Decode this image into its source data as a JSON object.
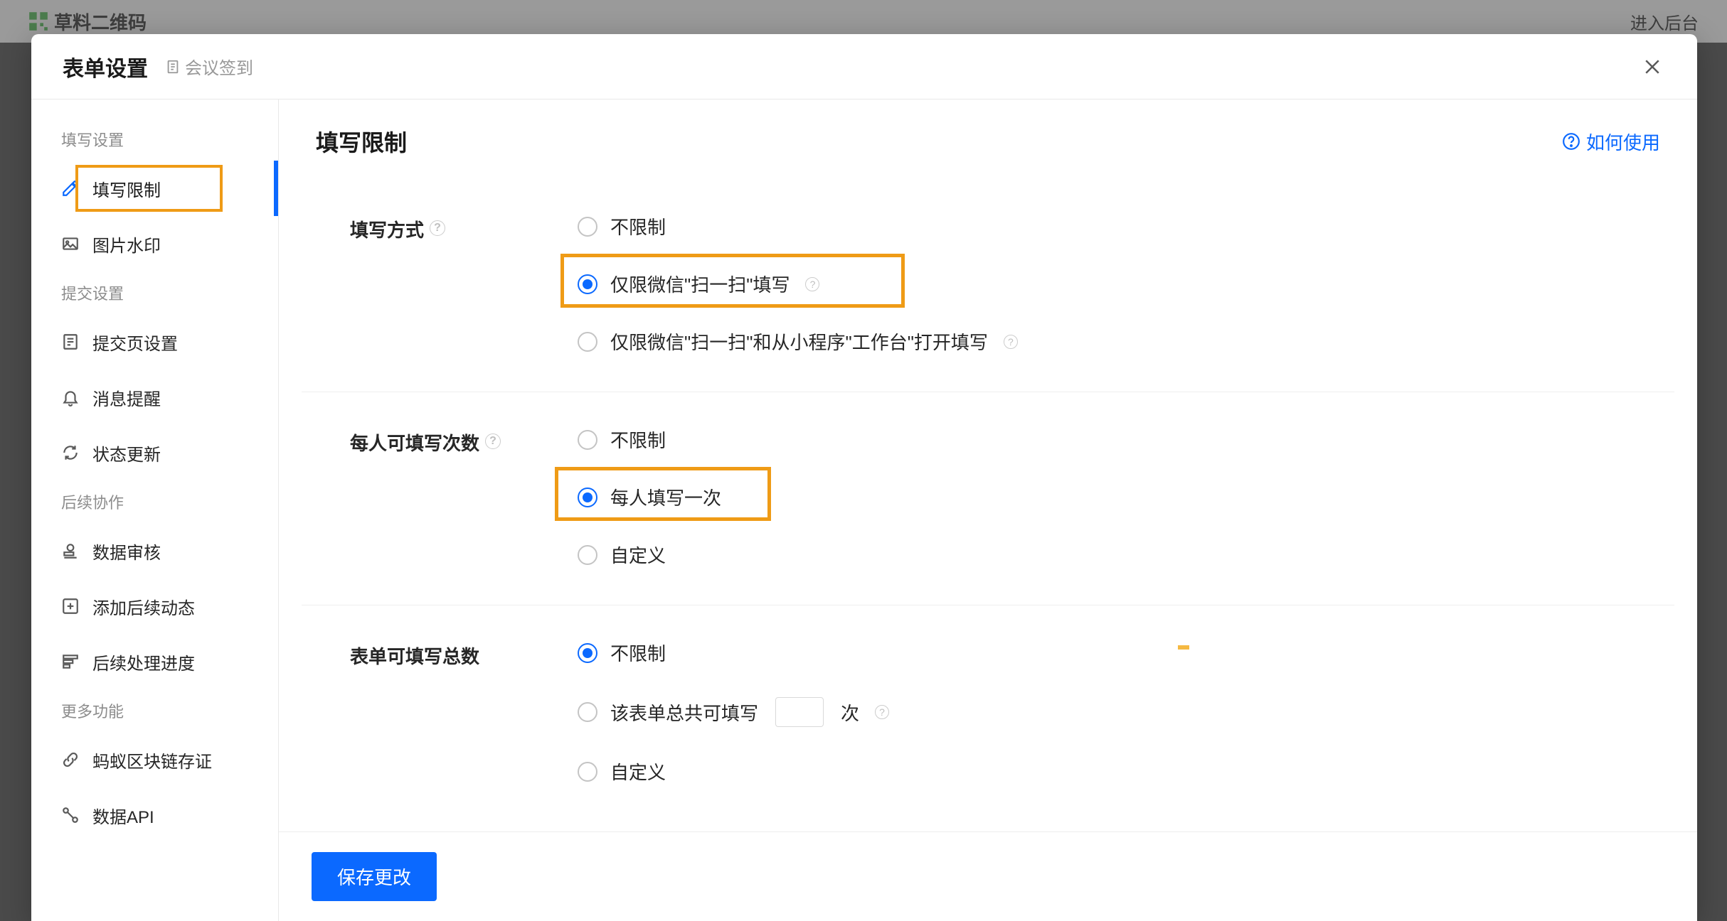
{
  "bg": {
    "logo_text": "草料二维码",
    "admin_link": "进入后台"
  },
  "modal": {
    "title": "表单设置",
    "breadcrumb": "会议签到",
    "close_label": "X"
  },
  "sidebar": {
    "sections": {
      "s1": "填写设置",
      "s2": "提交设置",
      "s3": "后续协作",
      "s4": "更多功能"
    },
    "items": {
      "fill_limit": "填写限制",
      "watermark": "图片水印",
      "submit_page": "提交页设置",
      "notify": "消息提醒",
      "status_update": "状态更新",
      "review": "数据审核",
      "followup": "添加后续动态",
      "progress": "后续处理进度",
      "blockchain": "蚂蚁区块链存证",
      "api": "数据API"
    }
  },
  "main": {
    "title": "填写限制",
    "help": "如何使用"
  },
  "section1": {
    "label": "填写方式",
    "opt1": "不限制",
    "opt2": "仅限微信\"扫一扫\"填写",
    "opt3": "仅限微信\"扫一扫\"和从小程序\"工作台\"打开填写"
  },
  "section2": {
    "label": "每人可填写次数",
    "opt1": "不限制",
    "opt2": "每人填写一次",
    "opt3": "自定义"
  },
  "section3": {
    "label": "表单可填写总数",
    "opt1": "不限制",
    "opt2_pre": "该表单总共可填写",
    "opt2_suf": "次",
    "opt3": "自定义"
  },
  "footer": {
    "save": "保存更改"
  }
}
